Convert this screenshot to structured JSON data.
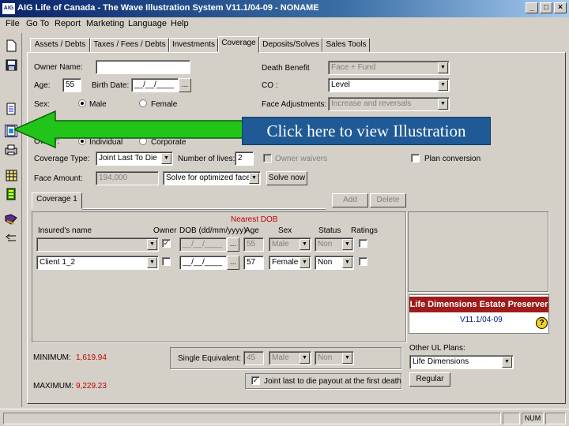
{
  "window": {
    "title": "AIG Life of Canada - The Wave Illustration System V11.1/04-09 - NONAME",
    "app_icon": "AIG",
    "minimize": "_",
    "maximize": "□",
    "close": "×"
  },
  "menu": [
    "File",
    "Go To",
    "Report",
    "Marketing",
    "Language",
    "Help"
  ],
  "tabs": [
    "Assets / Debts",
    "Taxes / Fees / Debts",
    "Investments",
    "Coverage",
    "Deposits/Solves",
    "Sales Tools"
  ],
  "active_tab": "Coverage",
  "toolbar_icons": [
    "new-icon",
    "save-icon",
    "report-icon",
    "illustration-icon",
    "print-icon",
    "calculator-icon",
    "chart-icon",
    "book-icon",
    "back-arrow-icon"
  ],
  "form": {
    "owner_name_label": "Owner Name:",
    "owner_name_value": "",
    "age_label": "Age:",
    "age_value": "55",
    "birth_date_label": "Birth Date:",
    "birth_date_value": "__/__/____",
    "dots": "...",
    "sex_label": "Sex:",
    "sex_male": "Male",
    "sex_female": "Female",
    "owner_type_label": "Owner:",
    "owner_individual": "Individual",
    "owner_corporate": "Corporate",
    "coverage_type_label": "Coverage Type:",
    "coverage_type_value": "Joint Last To Die",
    "num_lives_label": "Number of lives:",
    "num_lives_value": "2",
    "owner_waivers_label": "Owner waivers",
    "face_amount_label": "Face Amount:",
    "face_amount_value": "194,000",
    "solve_select_value": "Solve for optimized face",
    "solve_now_label": "Solve now",
    "death_benefit_label": "Death Benefit",
    "death_benefit_value": "Face + Fund",
    "coi_label": "CO :",
    "coi_value": "Level",
    "face_adjustments_label": "Face Adjustments:",
    "face_adjustments_value": "Increase and reversals",
    "plan_conversion_label": "Plan conversion"
  },
  "coverage": {
    "tab_label": "Coverage 1",
    "add_label": "Add",
    "delete_label": "Delete",
    "nearest_dob": "Nearest DOB",
    "headers": [
      "Insured's name",
      "Owner",
      "DOB (dd/mm/yyyy)",
      "Age",
      "Sex",
      "Status",
      "Ratings"
    ],
    "rows": [
      {
        "name": "",
        "owner_checked": "✓",
        "dob": "__/__/____",
        "age": "55",
        "sex": "Male",
        "status": "Non"
      },
      {
        "name": "Client 1_2",
        "owner_checked": "",
        "dob": "__/__/____",
        "age": "57",
        "sex": "Female",
        "status": "Non"
      }
    ]
  },
  "summary": {
    "minimum_label": "MINIMUM:",
    "minimum_value": "1,619.94",
    "maximum_label": "MAXIMUM:",
    "maximum_value": "9,229.23",
    "single_equiv_label": "Single Equivalent:",
    "single_equiv_age": "45",
    "single_equiv_sex": "Male",
    "single_equiv_status": "Non",
    "joint_payout_label": "Joint last to die payout at the first death"
  },
  "product": {
    "name": "Life Dimensions Estate Preserver",
    "version": "V11.1/04-09",
    "help": "?",
    "other_plans_label": "Other UL Plans:",
    "other_plans_value": "Life Dimensions",
    "regular_label": "Regular"
  },
  "callout": {
    "text": "Click here to view Illustration",
    "color": "#1f5a96",
    "arrow_color": "#22c41a"
  },
  "status": {
    "num": "NUM"
  }
}
